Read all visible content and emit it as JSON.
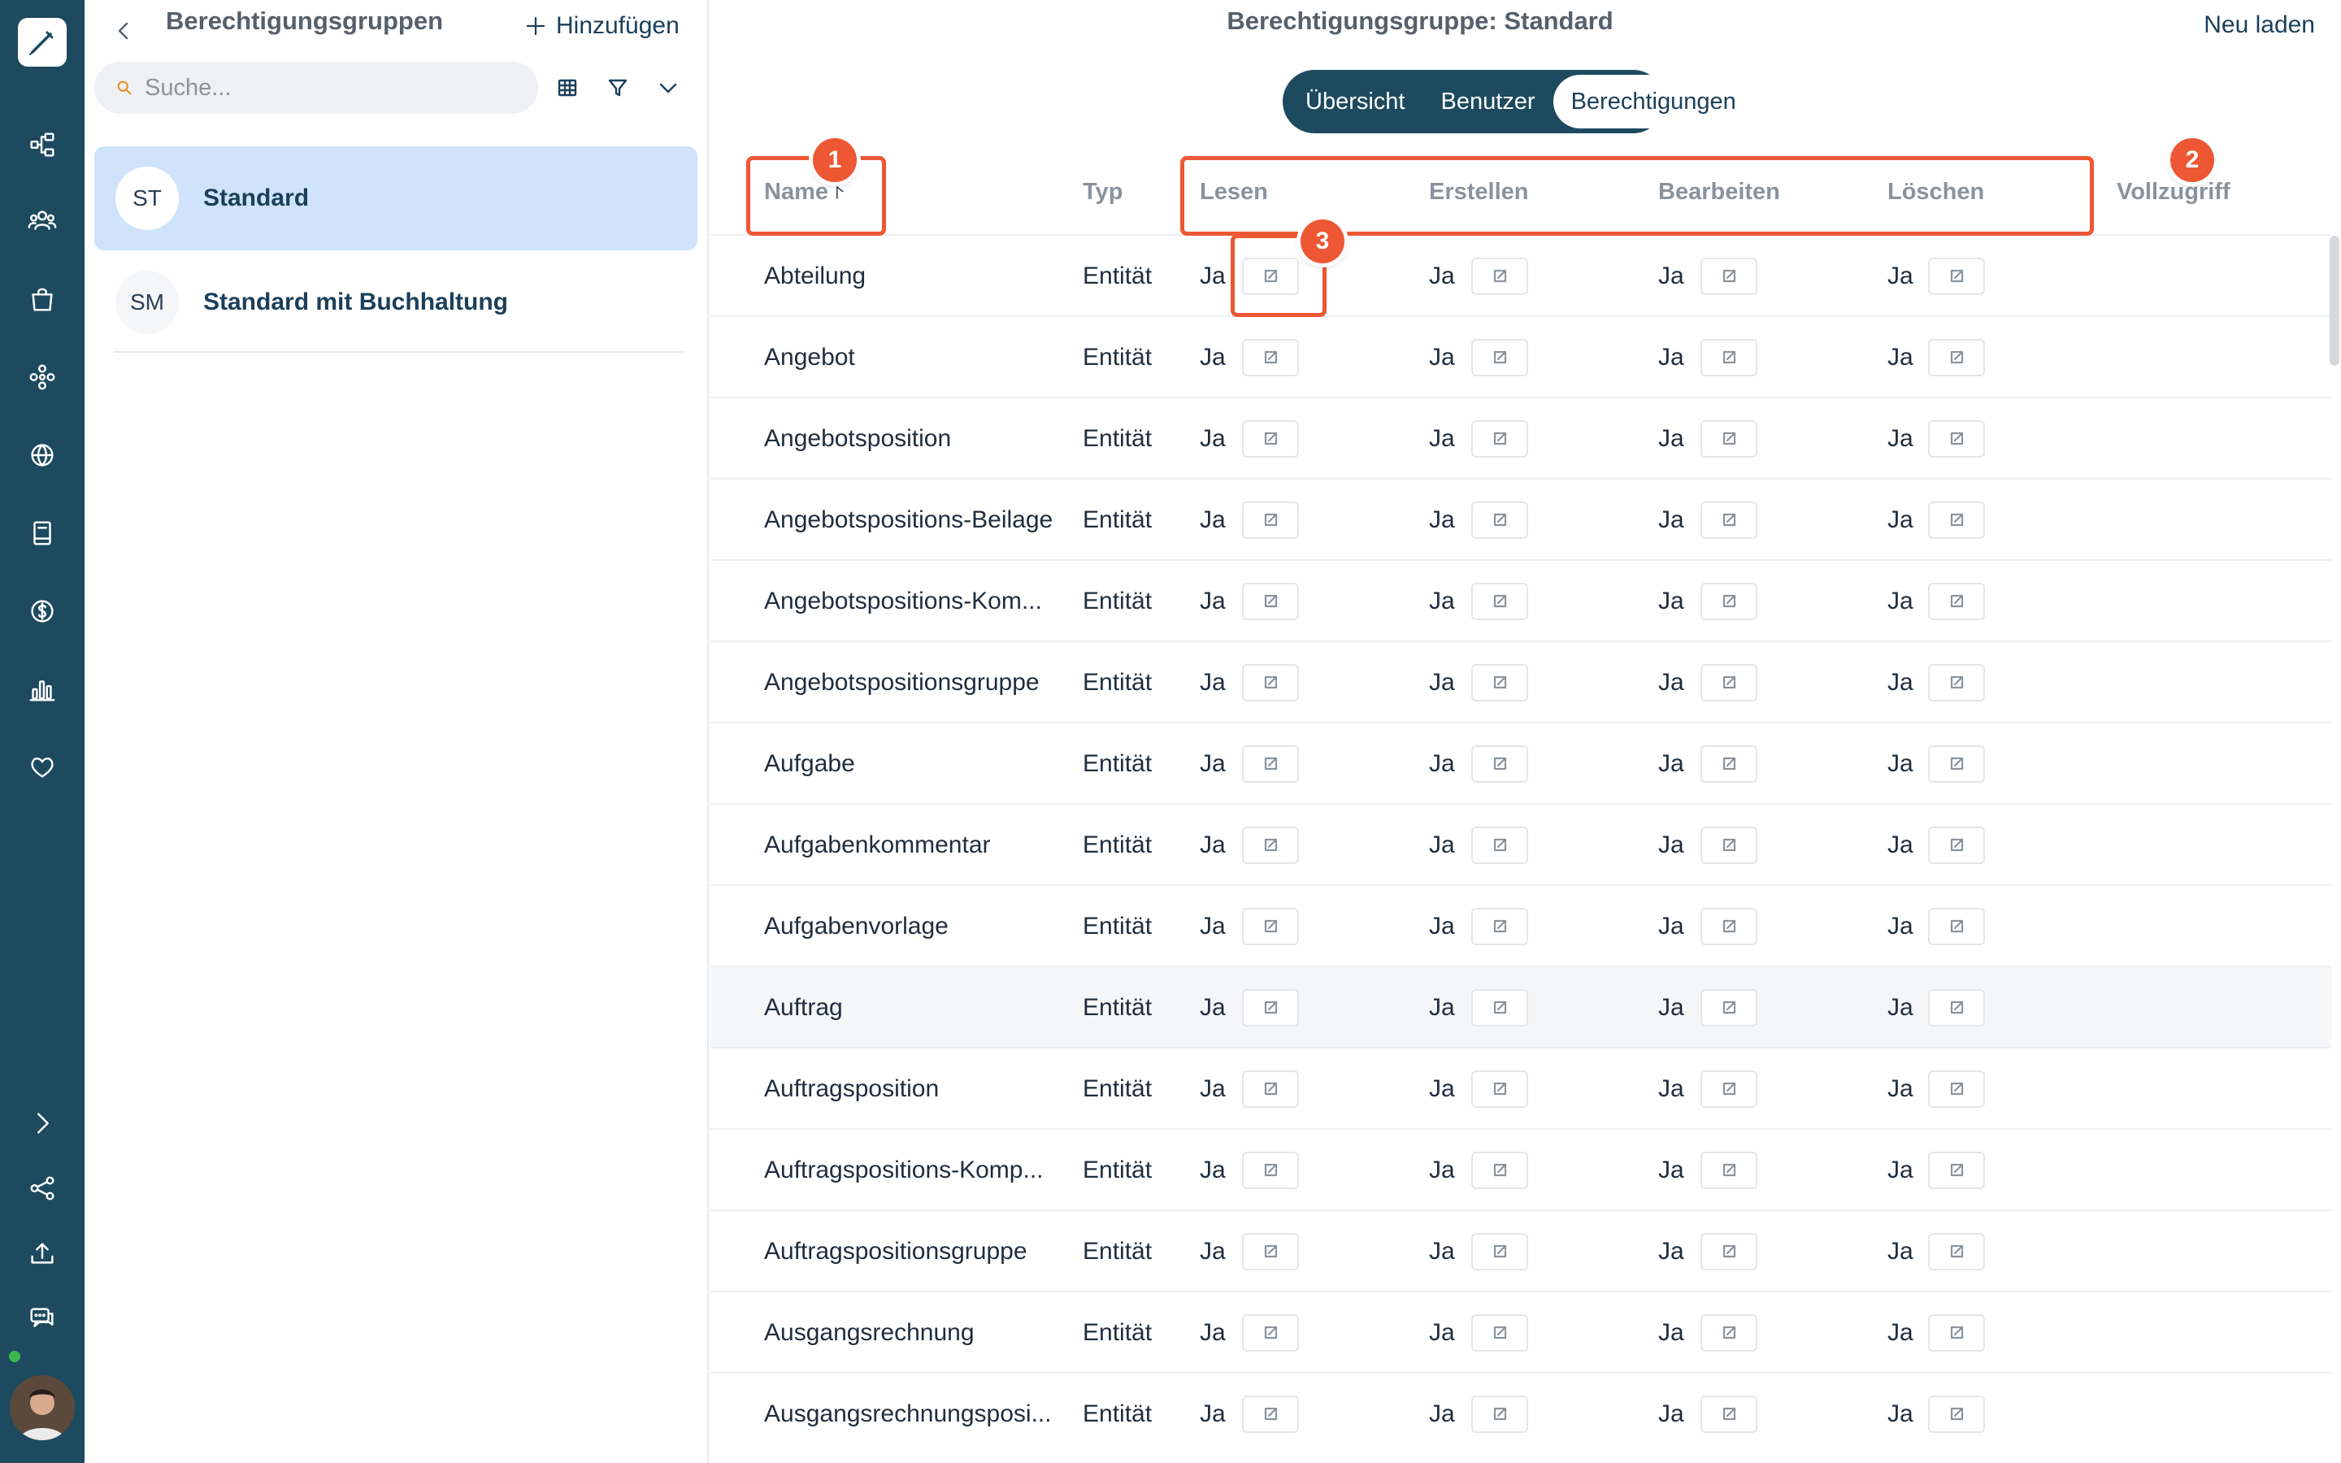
{
  "left_panel": {
    "title": "Berechtigungsgruppen",
    "add_label": "Hinzufügen",
    "search_placeholder": "Suche...",
    "groups": [
      {
        "initials": "ST",
        "name": "Standard",
        "selected": true
      },
      {
        "initials": "SM",
        "name": "Standard mit Buchhaltung",
        "selected": false
      }
    ]
  },
  "main": {
    "title": "Berechtigungsgruppe: Standard",
    "reload_label": "Neu laden",
    "tabs": [
      {
        "label": "Übersicht",
        "active": false
      },
      {
        "label": "Benutzer",
        "active": false
      },
      {
        "label": "Berechtigungen",
        "active": true
      }
    ],
    "columns": {
      "name": "Name",
      "type": "Typ",
      "read": "Lesen",
      "create": "Erstellen",
      "edit": "Bearbeiten",
      "delete": "Löschen",
      "full": "Vollzugriff"
    },
    "rows": [
      {
        "name": "Abteilung",
        "type": "Entität",
        "read": "Ja",
        "create": "Ja",
        "edit": "Ja",
        "delete": "Ja"
      },
      {
        "name": "Angebot",
        "type": "Entität",
        "read": "Ja",
        "create": "Ja",
        "edit": "Ja",
        "delete": "Ja"
      },
      {
        "name": "Angebotsposition",
        "type": "Entität",
        "read": "Ja",
        "create": "Ja",
        "edit": "Ja",
        "delete": "Ja"
      },
      {
        "name": "Angebotspositions-Beilage",
        "type": "Entität",
        "read": "Ja",
        "create": "Ja",
        "edit": "Ja",
        "delete": "Ja"
      },
      {
        "name": "Angebotspositions-Kom...",
        "type": "Entität",
        "read": "Ja",
        "create": "Ja",
        "edit": "Ja",
        "delete": "Ja"
      },
      {
        "name": "Angebotspositionsgruppe",
        "type": "Entität",
        "read": "Ja",
        "create": "Ja",
        "edit": "Ja",
        "delete": "Ja"
      },
      {
        "name": "Aufgabe",
        "type": "Entität",
        "read": "Ja",
        "create": "Ja",
        "edit": "Ja",
        "delete": "Ja"
      },
      {
        "name": "Aufgabenkommentar",
        "type": "Entität",
        "read": "Ja",
        "create": "Ja",
        "edit": "Ja",
        "delete": "Ja"
      },
      {
        "name": "Aufgabenvorlage",
        "type": "Entität",
        "read": "Ja",
        "create": "Ja",
        "edit": "Ja",
        "delete": "Ja"
      },
      {
        "name": "Auftrag",
        "type": "Entität",
        "read": "Ja",
        "create": "Ja",
        "edit": "Ja",
        "delete": "Ja"
      },
      {
        "name": "Auftragsposition",
        "type": "Entität",
        "read": "Ja",
        "create": "Ja",
        "edit": "Ja",
        "delete": "Ja"
      },
      {
        "name": "Auftragspositions-Komp...",
        "type": "Entität",
        "read": "Ja",
        "create": "Ja",
        "edit": "Ja",
        "delete": "Ja"
      },
      {
        "name": "Auftragspositionsgruppe",
        "type": "Entität",
        "read": "Ja",
        "create": "Ja",
        "edit": "Ja",
        "delete": "Ja"
      },
      {
        "name": "Ausgangsrechnung",
        "type": "Entität",
        "read": "Ja",
        "create": "Ja",
        "edit": "Ja",
        "delete": "Ja"
      },
      {
        "name": "Ausgangsrechnungsposi...",
        "type": "Entität",
        "read": "Ja",
        "create": "Ja",
        "edit": "Ja",
        "delete": "Ja"
      }
    ]
  },
  "annotations": [
    "1",
    "2",
    "3"
  ],
  "colors": {
    "rail": "#1d4a5e",
    "accent": "#1b3f5a",
    "selected": "#cfe3fa",
    "annotation": "#ee5733"
  }
}
